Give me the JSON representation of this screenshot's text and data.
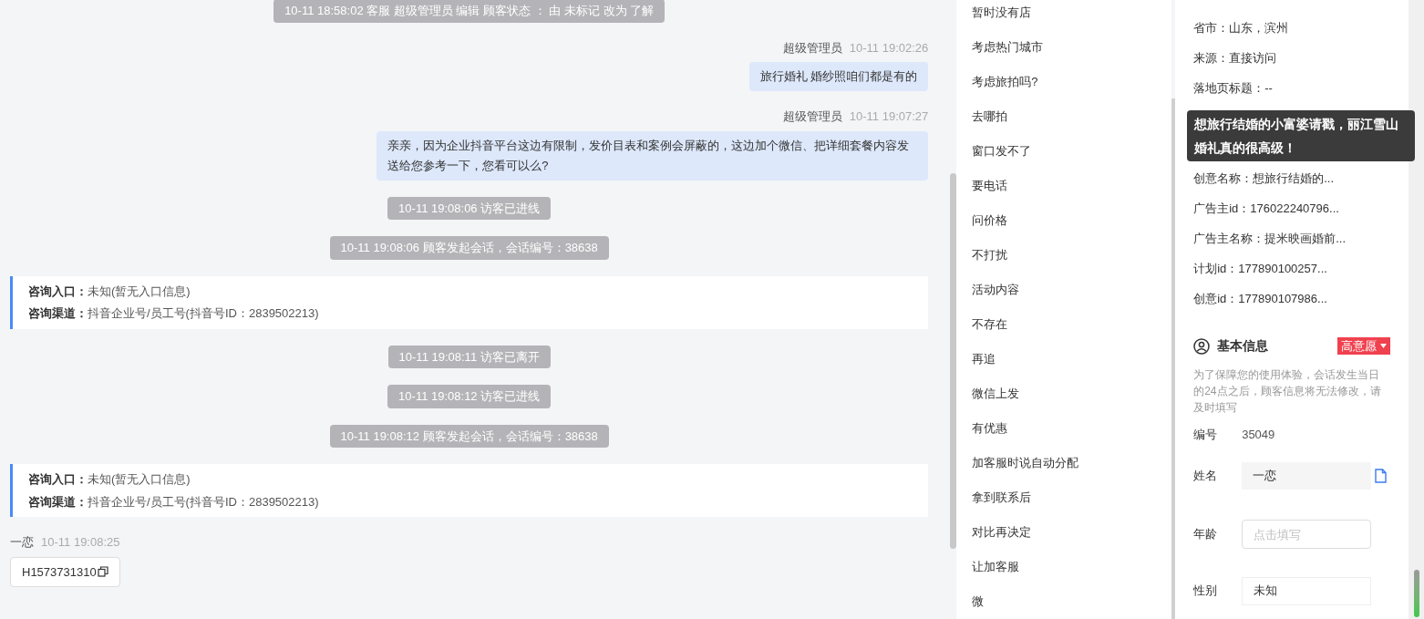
{
  "chat": [
    {
      "kind": "system",
      "text": "10-11 18:58:02 客服 超级管理员 编辑 顾客状态 ： 由 未标记 改为 了解"
    },
    {
      "kind": "agent",
      "sender": "超级管理员",
      "time": "10-11 19:02:26",
      "text": "旅行婚礼  婚纱照咱们都是有的"
    },
    {
      "kind": "agent",
      "sender": "超级管理员",
      "time": "10-11 19:07:27",
      "text": "亲亲，因为企业抖音平台这边有限制，发价目表和案例会屏蔽的，这边加个微信、把详细套餐内容发送给您参考一下，您看可以么?"
    },
    {
      "kind": "system",
      "text": "10-11 19:08:06 访客已进线"
    },
    {
      "kind": "system",
      "text": "10-11 19:08:06 顾客发起会话，会话编号：38638"
    },
    {
      "kind": "info",
      "rows": [
        {
          "label": "咨询入口：",
          "value": "未知(暂无入口信息)"
        },
        {
          "label": "咨询渠道：",
          "value": "抖音企业号/员工号(抖音号ID：2839502213)"
        }
      ]
    },
    {
      "kind": "system",
      "text": "10-11 19:08:11 访客已离开"
    },
    {
      "kind": "system",
      "text": "10-11 19:08:12 访客已进线"
    },
    {
      "kind": "system",
      "text": "10-11 19:08:12 顾客发起会话，会话编号：38638"
    },
    {
      "kind": "info",
      "rows": [
        {
          "label": "咨询入口：",
          "value": "未知(暂无入口信息)"
        },
        {
          "label": "咨询渠道：",
          "value": "抖音企业号/员工号(抖音号ID：2839502213)"
        }
      ]
    },
    {
      "kind": "visitor",
      "sender": "一恋",
      "time": "10-11 19:08:25",
      "text": "H1573731310"
    }
  ],
  "quick_replies": [
    "暂时没有店",
    "考虑热门城市",
    "考虑旅拍吗?",
    "去哪拍",
    "窗口发不了",
    "要电话",
    "问价格",
    "不打扰",
    "活动内容",
    "不存在",
    "再追",
    "微信上发",
    "有优惠",
    "加客服时说自动分配",
    "拿到联系后",
    "对比再决定",
    "让加客服",
    "微"
  ],
  "source_info": {
    "rows": [
      "省市：山东，滨州",
      "来源：直接访问",
      "落地页标题：--",
      "创意名称：想旅行结婚的...",
      "广告主id：176022240796...",
      "广告主名称：提米映画婚前...",
      "计划id：177890100257...",
      "创意id：177890107986..."
    ],
    "tooltip": "想旅行结婚的小富婆请戳，丽江雪山婚礼真的很高级！"
  },
  "basic_info": {
    "title": "基本信息",
    "intent_tag": "高意愿",
    "notice": "为了保障您的使用体验，会话发生当日的24点之后，顾客信息将无法修改，请及时填写",
    "fields": [
      {
        "kind": "text",
        "label": "编号",
        "value": "35049"
      },
      {
        "kind": "filled",
        "label": "姓名",
        "value": "一恋"
      },
      {
        "kind": "input",
        "label": "年龄",
        "placeholder": "点击填写"
      },
      {
        "kind": "select",
        "label": "性别",
        "value": "未知"
      }
    ]
  }
}
